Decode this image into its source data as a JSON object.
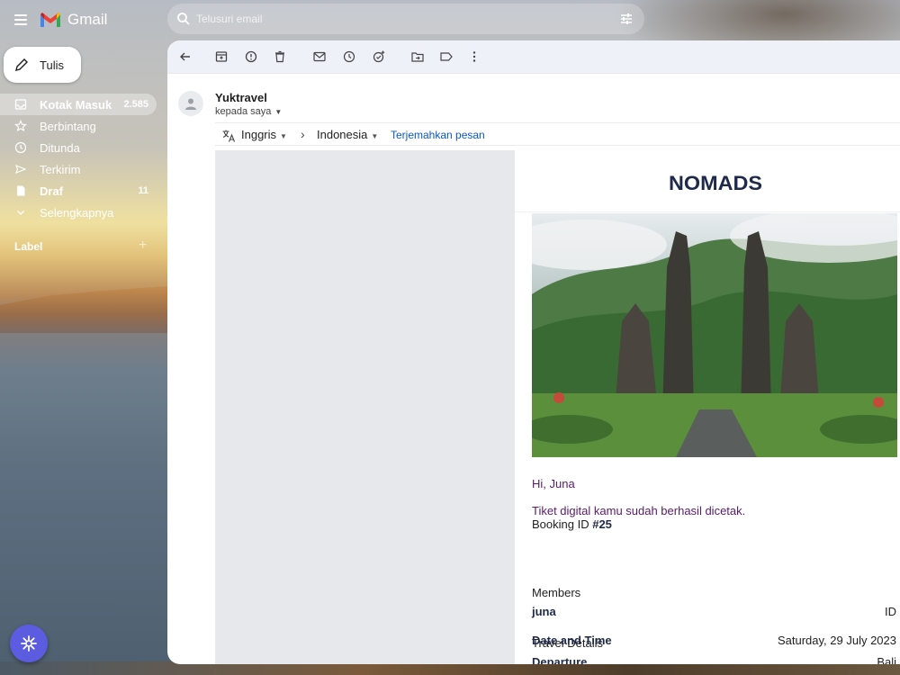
{
  "app": {
    "name": "Gmail"
  },
  "search": {
    "placeholder": "Telusuri email"
  },
  "compose": {
    "label": "Tulis"
  },
  "nav": [
    {
      "label": "Kotak Masuk",
      "count": "2.585",
      "icon": "inbox-icon"
    },
    {
      "label": "Berbintang",
      "count": "",
      "icon": "star-icon"
    },
    {
      "label": "Ditunda",
      "count": "",
      "icon": "clock-icon"
    },
    {
      "label": "Terkirim",
      "count": "",
      "icon": "send-icon"
    },
    {
      "label": "Draf",
      "count": "11",
      "icon": "draft-icon"
    },
    {
      "label": "Selengkapnya",
      "count": "",
      "icon": "chevron-down-icon"
    }
  ],
  "labels": {
    "heading": "Label",
    "add": "+"
  },
  "email": {
    "sender": "Yuktravel",
    "recipient": "kepada saya",
    "translate": {
      "from": "Inggris",
      "to": "Indonesia",
      "action": "Terjemahkan pesan"
    },
    "brand": "NOMADS",
    "greeting": "Hi, Juna",
    "message": "Tiket digital kamu sudah berhasil dicetak.",
    "booking_prefix": "Booking ID",
    "booking_id": "#25",
    "members_title": "Members",
    "member_name": "juna",
    "member_value": "ID",
    "travel_title": "Travel Details",
    "departure_label": "Departure",
    "departure_value": "Bali",
    "datetime_label": "Date and Time",
    "datetime_value": "Saturday, 29 July 2023"
  },
  "colors": {
    "accent_link": "#0b57d0",
    "greeting_text": "#5b1a6e",
    "brand_navy": "#1f2a4a",
    "fab": "#5b5ce0"
  }
}
